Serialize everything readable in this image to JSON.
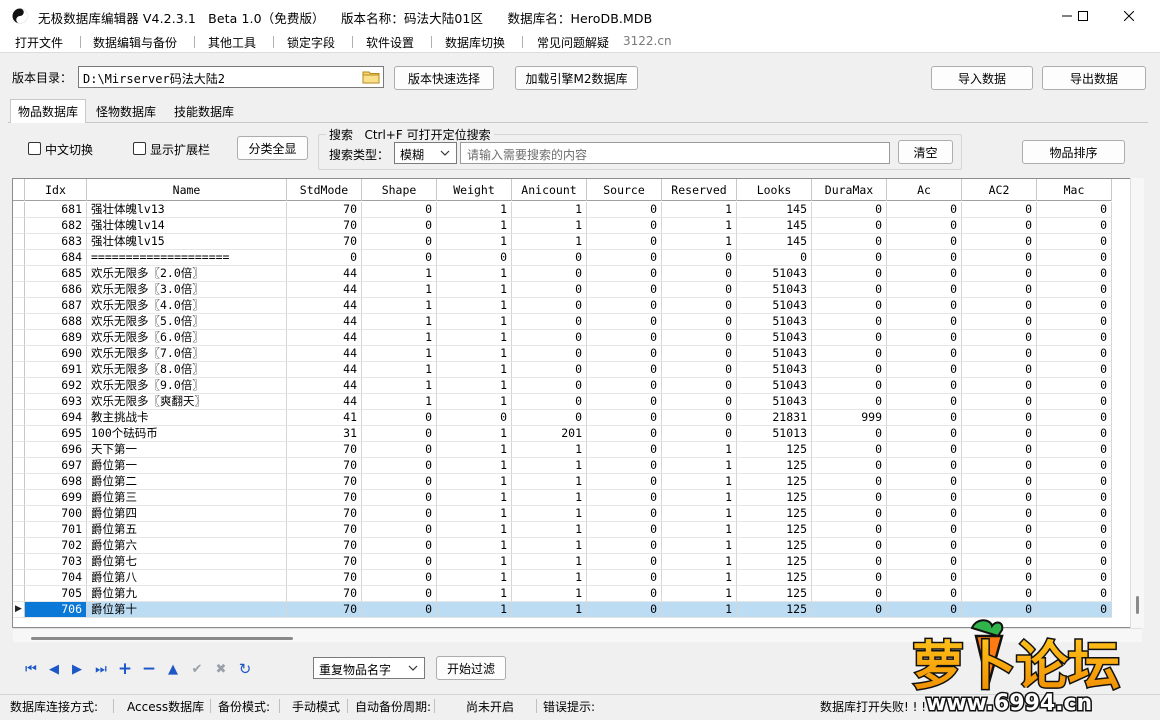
{
  "window": {
    "title": "无极数据库编辑器 V4.2.3.1   Beta 1.0（免费版）    版本名称：码法大陆01区      数据库名：HeroDB.MDB"
  },
  "menu": [
    "打开文件",
    "数据编辑与备份",
    "其他工具",
    "锁定字段",
    "软件设置",
    "数据库切换",
    "常见问题解疑",
    "3122.cn"
  ],
  "toolbar": {
    "version_dir_label": "版本目录：",
    "version_dir_value": "D:\\Mirserver码法大陆2",
    "quick_select": "版本快速选择",
    "load_engine": "加载引擎M2数据库",
    "import": "导入数据",
    "export": "导出数据"
  },
  "tabs": [
    "物品数据库",
    "怪物数据库",
    "技能数据库"
  ],
  "options": {
    "chinese_switch": "中文切换",
    "show_ext": "显示扩展栏",
    "show_all": "分类全显",
    "search_title": "搜索   Ctrl+F 可打开定位搜索",
    "search_type_label": "搜索类型：",
    "search_type_value": "模糊",
    "search_placeholder": "请输入需要搜索的内容",
    "clear": "清空",
    "sort": "物品排序"
  },
  "grid": {
    "columns": [
      "Idx",
      "Name",
      "StdMode",
      "Shape",
      "Weight",
      "Anicount",
      "Source",
      "Reserved",
      "Looks",
      "DuraMax",
      "Ac",
      "AC2",
      "Mac"
    ],
    "rows": [
      [
        "681",
        "强壮体魄lv13",
        "70",
        "0",
        "1",
        "1",
        "0",
        "1",
        "145",
        "0",
        "0",
        "0",
        "0"
      ],
      [
        "682",
        "强壮体魄lv14",
        "70",
        "0",
        "1",
        "1",
        "0",
        "1",
        "145",
        "0",
        "0",
        "0",
        "0"
      ],
      [
        "683",
        "强壮体魄lv15",
        "70",
        "0",
        "1",
        "1",
        "0",
        "1",
        "145",
        "0",
        "0",
        "0",
        "0"
      ],
      [
        "684",
        "====================",
        "0",
        "0",
        "0",
        "0",
        "0",
        "0",
        "0",
        "0",
        "0",
        "0",
        "0"
      ],
      [
        "685",
        "欢乐无限多〖2.0倍〗",
        "44",
        "1",
        "1",
        "0",
        "0",
        "0",
        "51043",
        "0",
        "0",
        "0",
        "0"
      ],
      [
        "686",
        "欢乐无限多〖3.0倍〗",
        "44",
        "1",
        "1",
        "0",
        "0",
        "0",
        "51043",
        "0",
        "0",
        "0",
        "0"
      ],
      [
        "687",
        "欢乐无限多〖4.0倍〗",
        "44",
        "1",
        "1",
        "0",
        "0",
        "0",
        "51043",
        "0",
        "0",
        "0",
        "0"
      ],
      [
        "688",
        "欢乐无限多〖5.0倍〗",
        "44",
        "1",
        "1",
        "0",
        "0",
        "0",
        "51043",
        "0",
        "0",
        "0",
        "0"
      ],
      [
        "689",
        "欢乐无限多〖6.0倍〗",
        "44",
        "1",
        "1",
        "0",
        "0",
        "0",
        "51043",
        "0",
        "0",
        "0",
        "0"
      ],
      [
        "690",
        "欢乐无限多〖7.0倍〗",
        "44",
        "1",
        "1",
        "0",
        "0",
        "0",
        "51043",
        "0",
        "0",
        "0",
        "0"
      ],
      [
        "691",
        "欢乐无限多〖8.0倍〗",
        "44",
        "1",
        "1",
        "0",
        "0",
        "0",
        "51043",
        "0",
        "0",
        "0",
        "0"
      ],
      [
        "692",
        "欢乐无限多〖9.0倍〗",
        "44",
        "1",
        "1",
        "0",
        "0",
        "0",
        "51043",
        "0",
        "0",
        "0",
        "0"
      ],
      [
        "693",
        "欢乐无限多〖爽翻天〗",
        "44",
        "1",
        "1",
        "0",
        "0",
        "0",
        "51043",
        "0",
        "0",
        "0",
        "0"
      ],
      [
        "694",
        "教主挑战卡",
        "41",
        "0",
        "0",
        "0",
        "0",
        "0",
        "21831",
        "999",
        "0",
        "0",
        "0"
      ],
      [
        "695",
        "100个砝码币",
        "31",
        "0",
        "1",
        "201",
        "0",
        "0",
        "51013",
        "0",
        "0",
        "0",
        "0"
      ],
      [
        "696",
        "天下第一",
        "70",
        "0",
        "1",
        "1",
        "0",
        "1",
        "125",
        "0",
        "0",
        "0",
        "0"
      ],
      [
        "697",
        "爵位第一",
        "70",
        "0",
        "1",
        "1",
        "0",
        "1",
        "125",
        "0",
        "0",
        "0",
        "0"
      ],
      [
        "698",
        "爵位第二",
        "70",
        "0",
        "1",
        "1",
        "0",
        "1",
        "125",
        "0",
        "0",
        "0",
        "0"
      ],
      [
        "699",
        "爵位第三",
        "70",
        "0",
        "1",
        "1",
        "0",
        "1",
        "125",
        "0",
        "0",
        "0",
        "0"
      ],
      [
        "700",
        "爵位第四",
        "70",
        "0",
        "1",
        "1",
        "0",
        "1",
        "125",
        "0",
        "0",
        "0",
        "0"
      ],
      [
        "701",
        "爵位第五",
        "70",
        "0",
        "1",
        "1",
        "0",
        "1",
        "125",
        "0",
        "0",
        "0",
        "0"
      ],
      [
        "702",
        "爵位第六",
        "70",
        "0",
        "1",
        "1",
        "0",
        "1",
        "125",
        "0",
        "0",
        "0",
        "0"
      ],
      [
        "703",
        "爵位第七",
        "70",
        "0",
        "1",
        "1",
        "0",
        "1",
        "125",
        "0",
        "0",
        "0",
        "0"
      ],
      [
        "704",
        "爵位第八",
        "70",
        "0",
        "1",
        "1",
        "0",
        "1",
        "125",
        "0",
        "0",
        "0",
        "0"
      ],
      [
        "705",
        "爵位第九",
        "70",
        "0",
        "1",
        "1",
        "0",
        "1",
        "125",
        "0",
        "0",
        "0",
        "0"
      ],
      [
        "706",
        "爵位第十",
        "70",
        "0",
        "1",
        "1",
        "0",
        "1",
        "125",
        "0",
        "0",
        "0",
        "0"
      ]
    ],
    "selected_idx": "706",
    "selected_color": "#bcdcf4",
    "selected_idx_color": "#0a78d7"
  },
  "bottom": {
    "nav_icons": [
      "first-icon",
      "prior-icon",
      "next-icon",
      "last-icon",
      "insert-icon",
      "delete-icon",
      "edit-icon",
      "post-icon",
      "cancel-icon",
      "refresh-icon"
    ],
    "dup_select": "重复物品名字",
    "start_filter": "开始过滤"
  },
  "status": {
    "conn_label": "数据库连接方式:",
    "conn_value": "Access数据库",
    "backup_label": "备份模式:",
    "backup_value": "手动模式",
    "auto_label": "自动备份周期:",
    "auto_value": "尚未开启",
    "error_label": "错误提示:",
    "error_value": "数据库打开失败! ! ! !"
  },
  "watermark": {
    "text": "萝卜论坛",
    "url": "www.6994.cn"
  }
}
